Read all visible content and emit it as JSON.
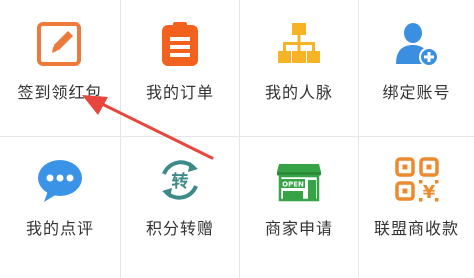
{
  "menu": {
    "items": [
      {
        "label": "签到领红包",
        "icon": "edit-pencil-icon",
        "color": "#ec7a3c"
      },
      {
        "label": "我的订单",
        "icon": "clipboard-icon",
        "color": "#f2621e"
      },
      {
        "label": "我的人脉",
        "icon": "network-icon",
        "color": "#f5b325"
      },
      {
        "label": "绑定账号",
        "icon": "user-add-icon",
        "color": "#3b8fe0"
      },
      {
        "label": "我的点评",
        "icon": "chat-bubble-icon",
        "color": "#3a93e6"
      },
      {
        "label": "积分转赠",
        "icon": "transfer-icon",
        "icon_text": "转",
        "color": "#3d8a89"
      },
      {
        "label": "商家申请",
        "icon": "shop-open-icon",
        "icon_text": "OPEN",
        "color": "#36a347"
      },
      {
        "label": "联盟商收款",
        "icon": "qr-yen-icon",
        "icon_text": "¥",
        "color": "#ec8a30"
      }
    ]
  },
  "annotation": {
    "arrow_color": "#e8453c"
  }
}
